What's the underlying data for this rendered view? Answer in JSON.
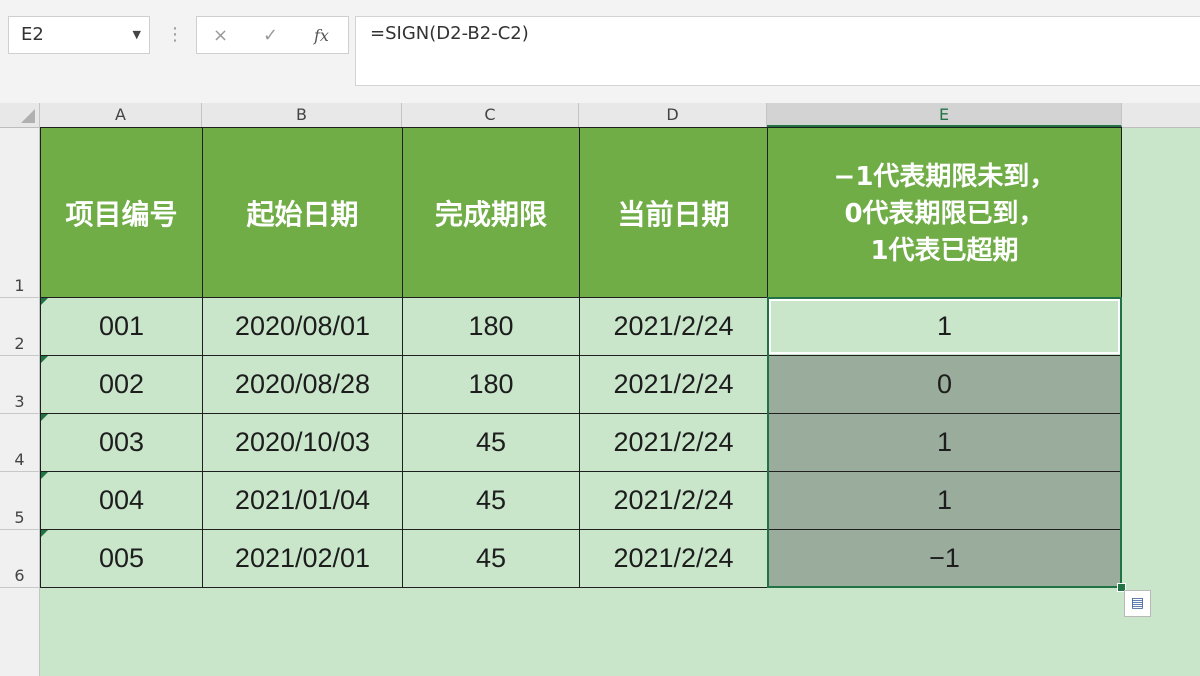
{
  "formula_bar": {
    "name_box": "E2",
    "cancel_icon": "×",
    "enter_icon": "✓",
    "fx_label": "fx",
    "formula": "=SIGN(D2-B2-C2)"
  },
  "columns": [
    "A",
    "B",
    "C",
    "D",
    "E"
  ],
  "selected_column": "E",
  "rows": [
    "1",
    "2",
    "3",
    "4",
    "5",
    "6"
  ],
  "table": {
    "headers": [
      "项目编号",
      "起始日期",
      "完成期限",
      "当前日期",
      "−1代表期限未到，\n0代表期限已到，\n 1代表已超期"
    ],
    "data": [
      [
        "001",
        "2020/08/01",
        "180",
        "2021/2/24",
        "1"
      ],
      [
        "002",
        "2020/08/28",
        "180",
        "2021/2/24",
        "0"
      ],
      [
        "003",
        "2020/10/03",
        "45",
        "2021/2/24",
        "1"
      ],
      [
        "004",
        "2021/01/04",
        "45",
        "2021/2/24",
        "1"
      ],
      [
        "005",
        "2021/02/01",
        "45",
        "2021/2/24",
        "−1"
      ]
    ]
  },
  "colors": {
    "header_fill": "#70ad47",
    "cell_fill": "#c9e6cb",
    "selection_fill": "#9aad9d",
    "selection_border": "#217346"
  },
  "icons": {
    "name_box_dropdown": "chevron-down-icon",
    "quick_analysis": "quick-analysis-icon"
  }
}
